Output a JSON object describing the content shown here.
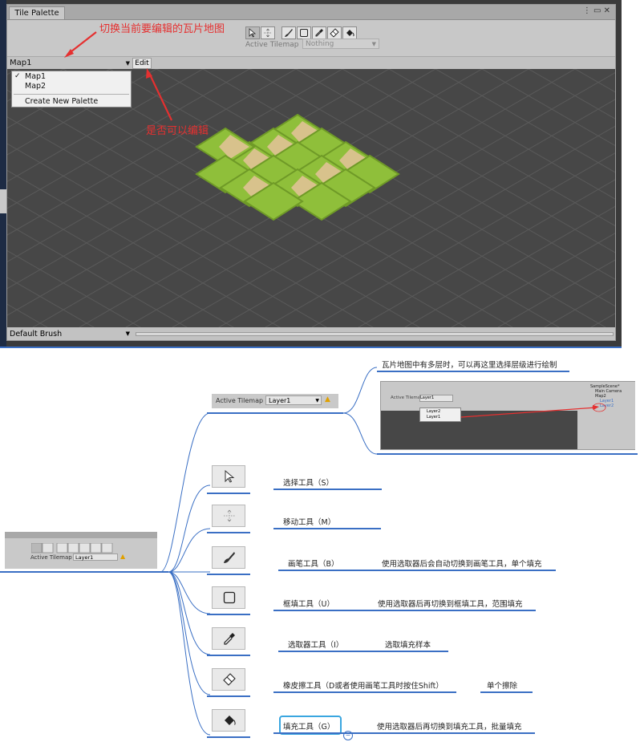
{
  "unity": {
    "tab_title": "Tile Palette",
    "window_controls": "⋮ ▭ ✕",
    "active_tilemap_label": "Active Tilemap",
    "active_tilemap_value": "Nothing",
    "palette_select": "Map1",
    "edit_button": "Edit",
    "dropdown_items": [
      "Map1",
      "Map2",
      "Create New Palette"
    ],
    "dropdown_checked": "✓",
    "brush_select": "Default Brush"
  },
  "annotations": {
    "switch_map": "切换当前要编辑的瓦片地图",
    "editable": "是否可以编辑"
  },
  "mindmap": {
    "root": {
      "active_tilemap_label": "Active Tilemap",
      "layer_value": "Layer1"
    },
    "active_tilemap_node": {
      "label": "Active Tilemap",
      "value": "Layer1",
      "note": "瓦片地图中有多层时，可以再这里选择层级进行绘制"
    },
    "hierarchy_preview": {
      "scene": "SampleScene*",
      "items": [
        "Main Camera",
        "Map2",
        "Layer1",
        "Layer2"
      ],
      "dropdown": [
        "Layer2",
        "Layer1"
      ],
      "label": "Active Tilemap",
      "value": "Layer1"
    },
    "tools": [
      {
        "name": "选择工具（S）",
        "icon": "select-arrow-icon",
        "note": ""
      },
      {
        "name": "移动工具（M）",
        "icon": "move-icon",
        "note": ""
      },
      {
        "name": "画笔工具（B）",
        "icon": "brush-icon",
        "note": "使用选取器后会自动切换到画笔工具，单个填充"
      },
      {
        "name": "框填工具（U）",
        "icon": "box-fill-icon",
        "note": "使用选取器后再切换到框填工具，范围填充"
      },
      {
        "name": "选取器工具（I）",
        "icon": "picker-icon",
        "note": "选取填充样本"
      },
      {
        "name": "橡皮擦工具（D或者使用画笔工具时按住Shift）",
        "icon": "eraser-icon",
        "note": "单个擦除"
      },
      {
        "name": "填充工具（G）",
        "icon": "fill-bucket-icon",
        "note": "使用选取器后再切换到填充工具，批量填充"
      }
    ]
  },
  "colors": {
    "accent": "#3a6fc4",
    "annotation_red": "#e53030",
    "grass": "#8fbf3a",
    "dirt": "#d8c28c"
  }
}
